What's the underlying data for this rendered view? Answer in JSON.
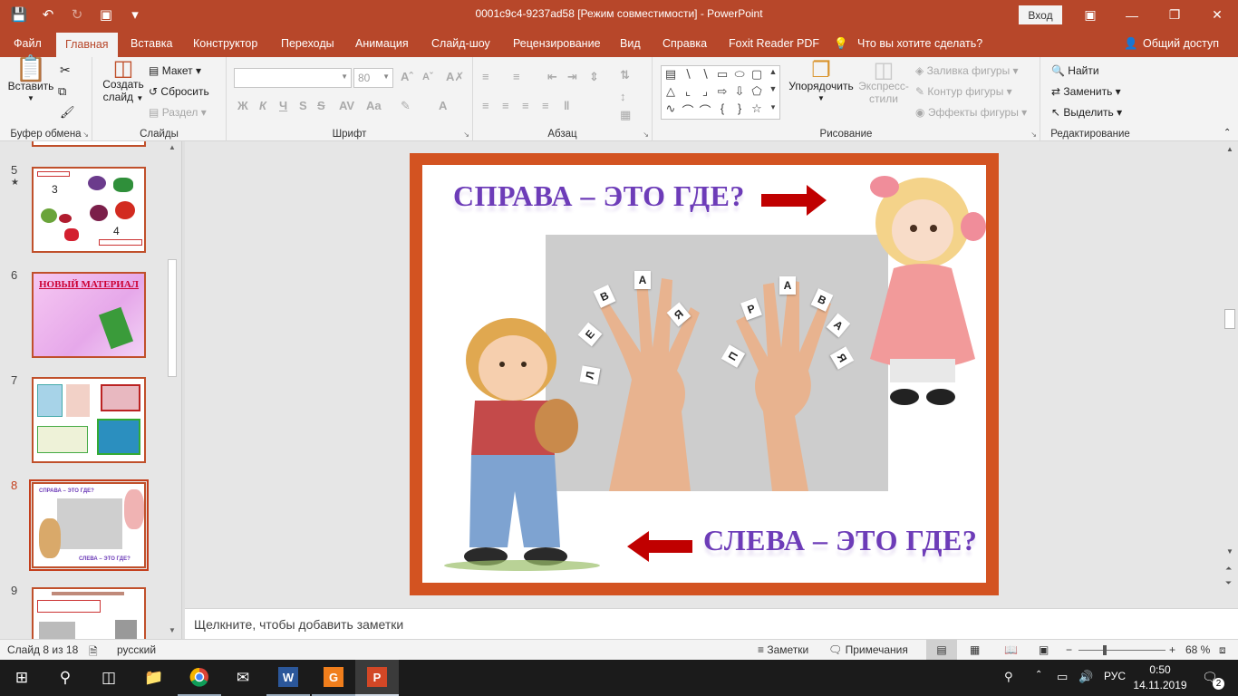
{
  "window": {
    "title": "0001c9c4-9237ad58 [Режим совместимости]  -  PowerPoint",
    "login_label": "Вход",
    "controls": [
      "ribbon-display-icon",
      "minimize-icon",
      "restore-icon",
      "close-icon"
    ]
  },
  "menu": {
    "tabs": [
      "Файл",
      "Главная",
      "Вставка",
      "Конструктор",
      "Переходы",
      "Анимация",
      "Слайд-шоу",
      "Рецензирование",
      "Вид",
      "Справка",
      "Foxit Reader PDF"
    ],
    "tell_me": "Что вы хотите сделать?",
    "share": "Общий доступ"
  },
  "ribbon": {
    "clipboard": {
      "label": "Буфер обмена",
      "paste": "Вставить"
    },
    "slides": {
      "label": "Слайды",
      "new_slide_line1": "Создать",
      "new_slide_line2": "слайд",
      "layout": "Макет",
      "reset": "Сбросить",
      "section": "Раздел"
    },
    "font": {
      "label": "Шрифт",
      "font_name": "",
      "font_size": "80",
      "bold": "Ж",
      "italic": "К",
      "underline": "Ч",
      "strike": "S"
    },
    "paragraph": {
      "label": "Абзац"
    },
    "drawing": {
      "label": "Рисование",
      "arrange": "Упорядочить",
      "quick_styles_line1": "Экспресс-",
      "quick_styles_line2": "стили",
      "fill": "Заливка фигуры",
      "outline": "Контур фигуры",
      "effects": "Эффекты фигуры"
    },
    "editing": {
      "label": "Редактирование",
      "find": "Найти",
      "replace": "Заменить",
      "select": "Выделить"
    }
  },
  "thumbnails": [
    {
      "number": "5",
      "star": "★",
      "num_label": "3",
      "num_label2": "4"
    },
    {
      "number": "6",
      "title": "НОВЫЙ МАТЕРИАЛ"
    },
    {
      "number": "7"
    },
    {
      "number": "8",
      "title_top": "СПРАВА – ЭТО ГДЕ?",
      "title_bottom": "СЛЕВА – ЭТО ГДЕ?"
    },
    {
      "number": "9"
    }
  ],
  "slide": {
    "title_top": "СПРАВА – ЭТО ГДЕ?",
    "title_bottom": "СЛЕВА – ЭТО ГДЕ?",
    "left_letters": [
      "Л",
      "Е",
      "В",
      "А",
      "Я"
    ],
    "right_letters": [
      "П",
      "Р",
      "А",
      "В",
      "А",
      "Я"
    ],
    "colors": {
      "frame": "#d35321",
      "title": "#6d3cb8",
      "arrow": "#c00000"
    }
  },
  "notes": {
    "placeholder": "Щелкните, чтобы добавить заметки"
  },
  "status": {
    "slide_info": "Слайд 8 из 18",
    "language": "русский",
    "notes": "Заметки",
    "comments": "Примечания",
    "zoom": "68 %",
    "zoom_minus": "−",
    "zoom_plus": "+"
  },
  "taskbar": {
    "lang": "РУС",
    "time": "0:50",
    "date": "14.11.2019",
    "notif_count": "2"
  }
}
